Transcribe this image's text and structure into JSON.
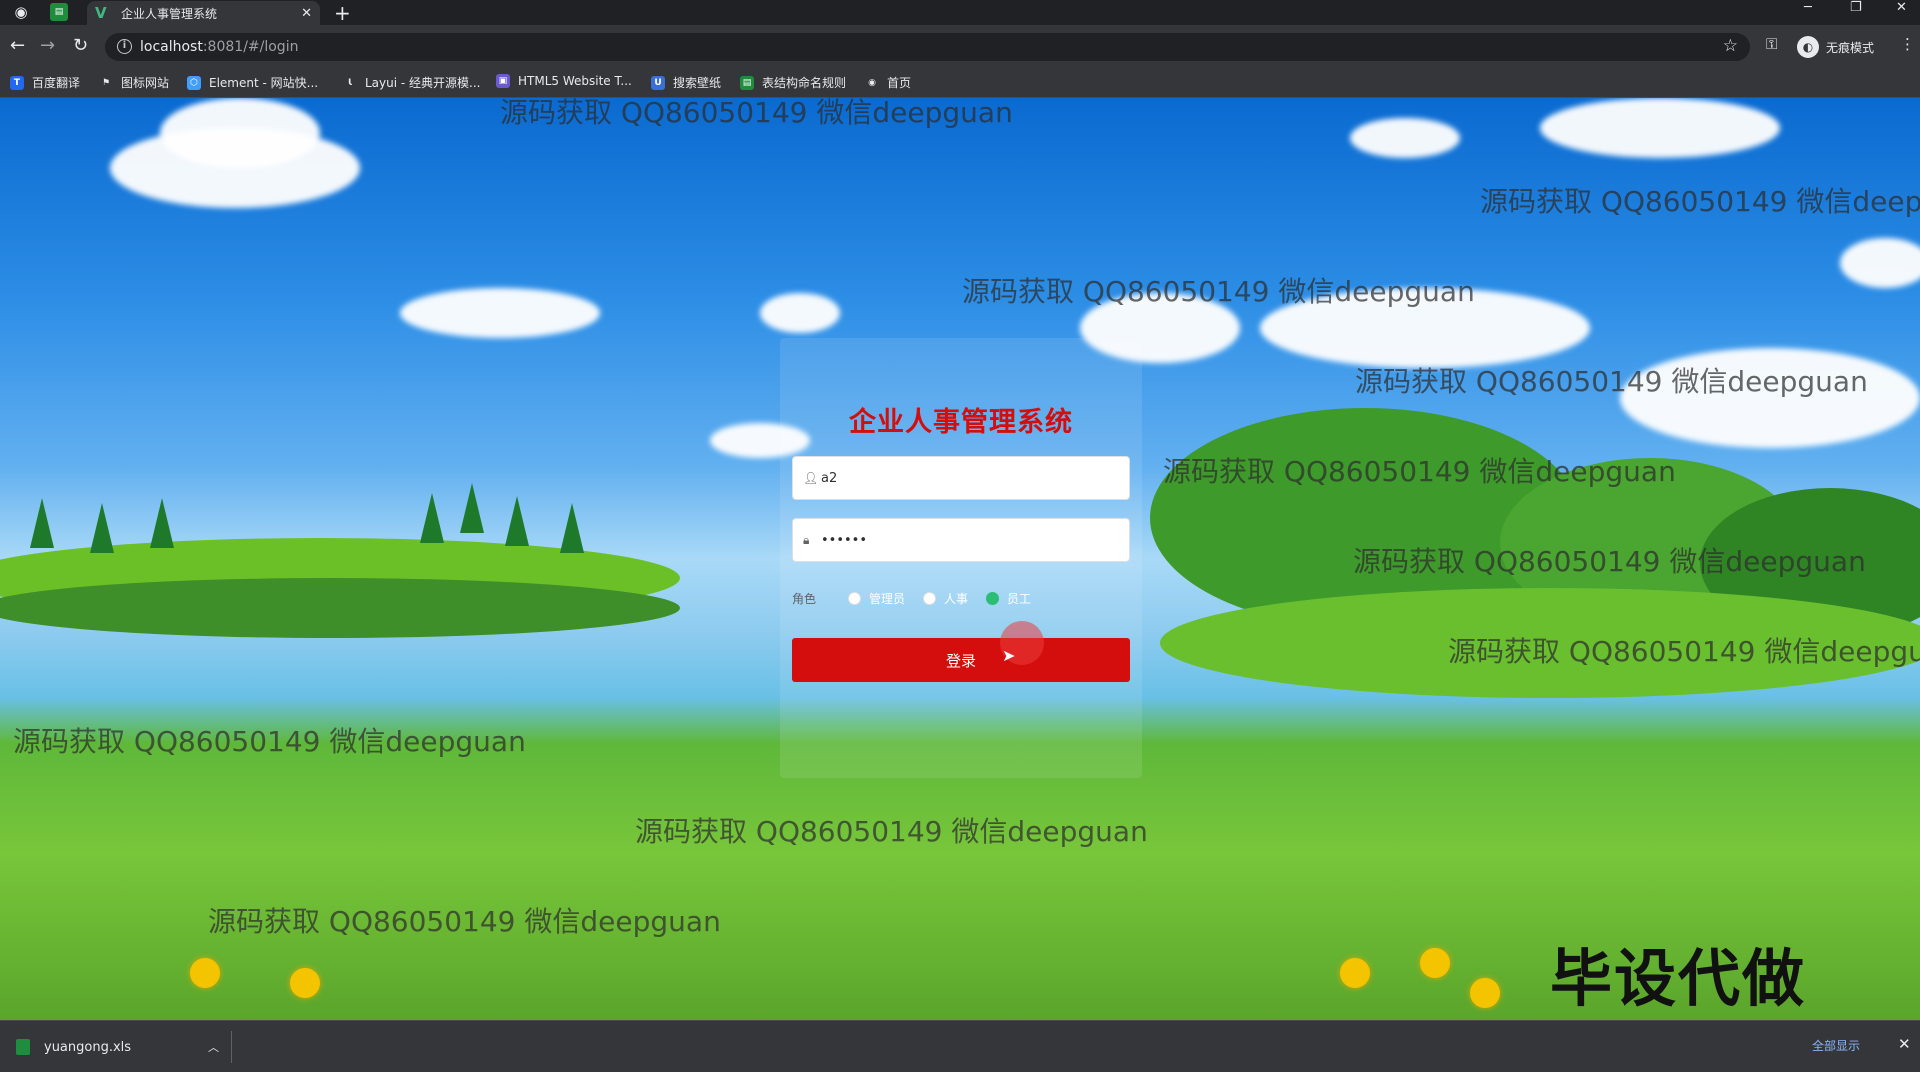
{
  "tab": {
    "title": "企业人事管理系统"
  },
  "address": {
    "host": "localhost",
    "path": ":8081/#/login"
  },
  "profile": {
    "label": "无痕模式"
  },
  "bookmarks": [
    {
      "label": "百度翻译"
    },
    {
      "label": "图标网站"
    },
    {
      "label": "Element - 网站快..."
    },
    {
      "label": "Layui - 经典开源模..."
    },
    {
      "label": "HTML5 Website T..."
    },
    {
      "label": "搜索壁纸"
    },
    {
      "label": "表结构命名规则"
    },
    {
      "label": "首页"
    }
  ],
  "login": {
    "title": "企业人事管理系统",
    "username": "a2",
    "password": "••••••",
    "role_label": "角色",
    "roles": [
      {
        "label": "管理员",
        "checked": false
      },
      {
        "label": "人事",
        "checked": false
      },
      {
        "label": "员工",
        "checked": true
      }
    ],
    "submit": "登录"
  },
  "watermark": "源码获取 QQ86050149 微信deepguan",
  "stamp": "毕设代做",
  "downloads": {
    "file": "yuangong.xls",
    "show_all": "全部显示"
  }
}
